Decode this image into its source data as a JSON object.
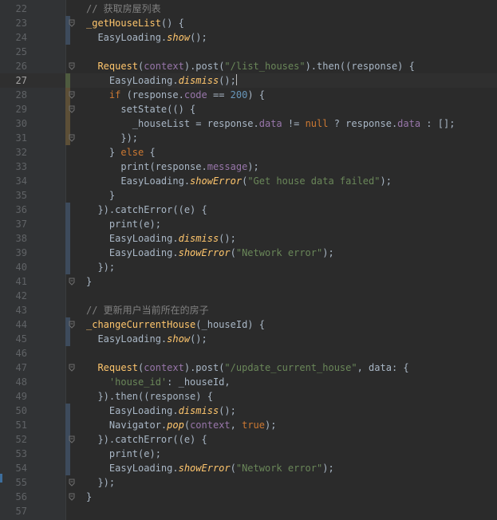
{
  "theme": {
    "background": "#2b2b2b",
    "gutter": "#313335",
    "colors": {
      "plain": "#a9b7c6",
      "keyword": "#cc7832",
      "function": "#ffc66d",
      "string": "#6a8759",
      "number": "#6897bb",
      "field": "#9876aa",
      "comment": "#808080"
    }
  },
  "editor": {
    "current_line": 27,
    "lines": [
      {
        "n": "22",
        "tokens": [
          {
            "t": "// 获取房屋列表",
            "c": "comment"
          }
        ]
      },
      {
        "n": "23",
        "tokens": [
          {
            "t": "_getHouseList",
            "c": "fn"
          },
          {
            "t": "() {",
            "c": "plain"
          }
        ]
      },
      {
        "n": "24",
        "tokens": [
          {
            "t": "  EasyLoading.",
            "c": "plain"
          },
          {
            "t": "show",
            "c": "ital"
          },
          {
            "t": "();",
            "c": "plain"
          }
        ]
      },
      {
        "n": "25",
        "tokens": []
      },
      {
        "n": "26",
        "tokens": [
          {
            "t": "  ",
            "c": "plain"
          },
          {
            "t": "Request",
            "c": "fn"
          },
          {
            "t": "(",
            "c": "plain"
          },
          {
            "t": "context",
            "c": "param"
          },
          {
            "t": ").post(",
            "c": "plain"
          },
          {
            "t": "\"/list_houses\"",
            "c": "str"
          },
          {
            "t": ").then((response) {",
            "c": "plain"
          }
        ]
      },
      {
        "n": "27",
        "tokens": [
          {
            "t": "    EasyLoading.",
            "c": "plain"
          },
          {
            "t": "dismiss",
            "c": "ital"
          },
          {
            "t": "();",
            "c": "plain"
          }
        ]
      },
      {
        "n": "28",
        "tokens": [
          {
            "t": "    ",
            "c": "plain"
          },
          {
            "t": "if",
            "c": "kw"
          },
          {
            "t": " (response.",
            "c": "plain"
          },
          {
            "t": "code",
            "c": "field"
          },
          {
            "t": " == ",
            "c": "plain"
          },
          {
            "t": "200",
            "c": "num"
          },
          {
            "t": ") {",
            "c": "plain"
          }
        ]
      },
      {
        "n": "29",
        "tokens": [
          {
            "t": "      setState(() {",
            "c": "plain"
          }
        ]
      },
      {
        "n": "30",
        "tokens": [
          {
            "t": "        _houseList = response.",
            "c": "plain"
          },
          {
            "t": "data",
            "c": "field"
          },
          {
            "t": " != ",
            "c": "plain"
          },
          {
            "t": "null",
            "c": "kw"
          },
          {
            "t": " ? response.",
            "c": "plain"
          },
          {
            "t": "data",
            "c": "field"
          },
          {
            "t": " : [];",
            "c": "plain"
          }
        ]
      },
      {
        "n": "31",
        "tokens": [
          {
            "t": "      });",
            "c": "plain"
          }
        ]
      },
      {
        "n": "32",
        "tokens": [
          {
            "t": "    } ",
            "c": "plain"
          },
          {
            "t": "else",
            "c": "kw"
          },
          {
            "t": " {",
            "c": "plain"
          }
        ]
      },
      {
        "n": "33",
        "tokens": [
          {
            "t": "      print(response.",
            "c": "plain"
          },
          {
            "t": "message",
            "c": "field"
          },
          {
            "t": ");",
            "c": "plain"
          }
        ]
      },
      {
        "n": "34",
        "tokens": [
          {
            "t": "      EasyLoading.",
            "c": "plain"
          },
          {
            "t": "showError",
            "c": "ital"
          },
          {
            "t": "(",
            "c": "plain"
          },
          {
            "t": "\"Get house data failed\"",
            "c": "str"
          },
          {
            "t": ");",
            "c": "plain"
          }
        ]
      },
      {
        "n": "35",
        "tokens": [
          {
            "t": "    }",
            "c": "plain"
          }
        ]
      },
      {
        "n": "36",
        "tokens": [
          {
            "t": "  }).catchError((e) {",
            "c": "plain"
          }
        ]
      },
      {
        "n": "37",
        "tokens": [
          {
            "t": "    print(e);",
            "c": "plain"
          }
        ]
      },
      {
        "n": "38",
        "tokens": [
          {
            "t": "    EasyLoading.",
            "c": "plain"
          },
          {
            "t": "dismiss",
            "c": "ital"
          },
          {
            "t": "();",
            "c": "plain"
          }
        ]
      },
      {
        "n": "39",
        "tokens": [
          {
            "t": "    EasyLoading.",
            "c": "plain"
          },
          {
            "t": "showError",
            "c": "ital"
          },
          {
            "t": "(",
            "c": "plain"
          },
          {
            "t": "\"Network error\"",
            "c": "str"
          },
          {
            "t": ");",
            "c": "plain"
          }
        ]
      },
      {
        "n": "40",
        "tokens": [
          {
            "t": "  });",
            "c": "plain"
          }
        ]
      },
      {
        "n": "41",
        "tokens": [
          {
            "t": "}",
            "c": "plain"
          }
        ]
      },
      {
        "n": "42",
        "tokens": []
      },
      {
        "n": "43",
        "tokens": [
          {
            "t": "// 更新用户当前所在的房子",
            "c": "comment"
          }
        ]
      },
      {
        "n": "44",
        "tokens": [
          {
            "t": "_changeCurrentHouse",
            "c": "fn"
          },
          {
            "t": "(_houseId) {",
            "c": "plain"
          }
        ]
      },
      {
        "n": "45",
        "tokens": [
          {
            "t": "  EasyLoading.",
            "c": "plain"
          },
          {
            "t": "show",
            "c": "ital"
          },
          {
            "t": "();",
            "c": "plain"
          }
        ]
      },
      {
        "n": "46",
        "tokens": []
      },
      {
        "n": "47",
        "tokens": [
          {
            "t": "  ",
            "c": "plain"
          },
          {
            "t": "Request",
            "c": "fn"
          },
          {
            "t": "(",
            "c": "plain"
          },
          {
            "t": "context",
            "c": "param"
          },
          {
            "t": ").post(",
            "c": "plain"
          },
          {
            "t": "\"/update_current_house\"",
            "c": "str"
          },
          {
            "t": ", data: {",
            "c": "plain"
          }
        ]
      },
      {
        "n": "48",
        "tokens": [
          {
            "t": "    ",
            "c": "plain"
          },
          {
            "t": "'house_id'",
            "c": "str"
          },
          {
            "t": ": _houseId,",
            "c": "plain"
          }
        ]
      },
      {
        "n": "49",
        "tokens": [
          {
            "t": "  }).then((response) {",
            "c": "plain"
          }
        ]
      },
      {
        "n": "50",
        "tokens": [
          {
            "t": "    EasyLoading.",
            "c": "plain"
          },
          {
            "t": "dismiss",
            "c": "ital"
          },
          {
            "t": "();",
            "c": "plain"
          }
        ]
      },
      {
        "n": "51",
        "tokens": [
          {
            "t": "    Navigator.",
            "c": "plain"
          },
          {
            "t": "pop",
            "c": "ital"
          },
          {
            "t": "(",
            "c": "plain"
          },
          {
            "t": "context",
            "c": "param"
          },
          {
            "t": ", ",
            "c": "plain"
          },
          {
            "t": "true",
            "c": "kw"
          },
          {
            "t": ");",
            "c": "plain"
          }
        ]
      },
      {
        "n": "52",
        "tokens": [
          {
            "t": "  }).catchError((e) {",
            "c": "plain"
          }
        ]
      },
      {
        "n": "53",
        "tokens": [
          {
            "t": "    print(e);",
            "c": "plain"
          }
        ]
      },
      {
        "n": "54",
        "tokens": [
          {
            "t": "    EasyLoading.",
            "c": "plain"
          },
          {
            "t": "showError",
            "c": "ital"
          },
          {
            "t": "(",
            "c": "plain"
          },
          {
            "t": "\"Network error\"",
            "c": "str"
          },
          {
            "t": ");",
            "c": "plain"
          }
        ]
      },
      {
        "n": "55",
        "tokens": [
          {
            "t": "  });",
            "c": "plain"
          }
        ]
      },
      {
        "n": "56",
        "tokens": [
          {
            "t": "}",
            "c": "plain"
          }
        ]
      },
      {
        "n": "57",
        "tokens": []
      }
    ]
  }
}
